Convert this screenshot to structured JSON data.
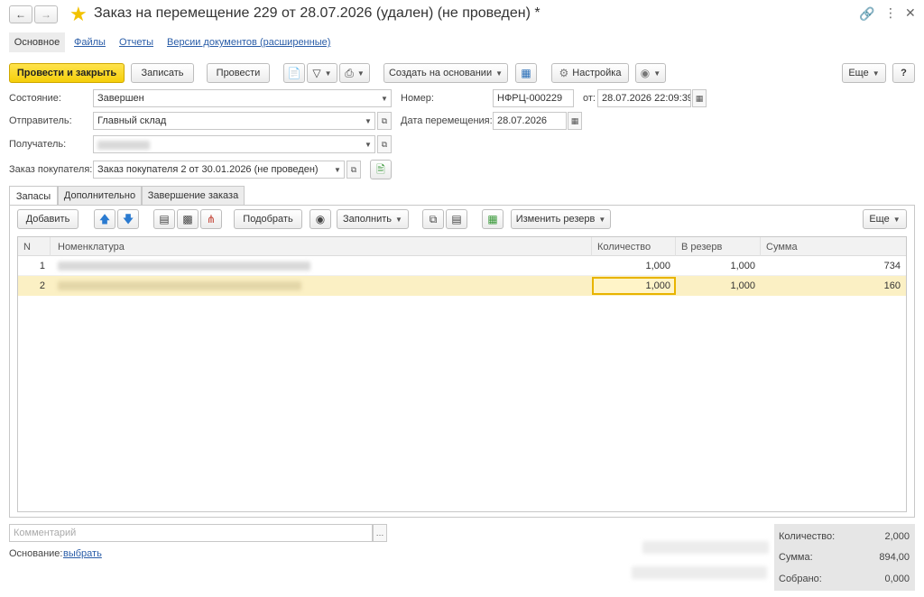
{
  "window": {
    "title": "Заказ на перемещение 229 от 28.07.2026 (удален) (не проведен) *"
  },
  "nav_tabs": [
    "Основное",
    "Файлы",
    "Отчеты",
    "Версии документов (расширенные)"
  ],
  "toolbar": {
    "post_close": "Провести и закрыть",
    "save": "Записать",
    "post": "Провести",
    "create_based": "Создать на основании",
    "settings": "Настройка",
    "more": "Еще",
    "help": "?"
  },
  "form": {
    "status_label": "Состояние:",
    "status_value": "Завершен",
    "sender_label": "Отправитель:",
    "sender_value": "Главный склад",
    "recipient_label": "Получатель:",
    "customer_order_label": "Заказ покупателя:",
    "customer_order_value": "Заказ покупателя 2 от 30.01.2026 (не проведен)",
    "number_label": "Номер:",
    "number_value": "НФРЦ-000229",
    "from_label": "от:",
    "from_value": "28.07.2026 22:09:39",
    "move_date_label": "Дата перемещения:",
    "move_date_value": "28.07.2026"
  },
  "content_tabs": [
    "Запасы",
    "Дополнительно",
    "Завершение заказа"
  ],
  "table_toolbar": {
    "add": "Добавить",
    "pick": "Подобрать",
    "fill": "Заполнить",
    "change_reserve": "Изменить резерв",
    "more": "Еще"
  },
  "table": {
    "columns": [
      "N",
      "Номенклатура",
      "Количество",
      "В резерв",
      "Сумма"
    ],
    "rows": [
      {
        "n": "1",
        "qty": "1,000",
        "reserve": "1,000",
        "sum": "734"
      },
      {
        "n": "2",
        "qty": "1,000",
        "reserve": "1,000",
        "sum": "160"
      }
    ]
  },
  "footer": {
    "comment_placeholder": "Комментарий",
    "basis_label": "Основание:",
    "basis_link": "выбрать",
    "totals": [
      {
        "label": "Количество:",
        "value": "2,000"
      },
      {
        "label": "Сумма:",
        "value": "894,00"
      },
      {
        "label": "Собрано:",
        "value": "0,000"
      }
    ]
  },
  "colors": {
    "primary_button": "#f5cf0a",
    "selected_row": "#fbf0c4",
    "link": "#2a5da8",
    "star": "#f2c200"
  }
}
